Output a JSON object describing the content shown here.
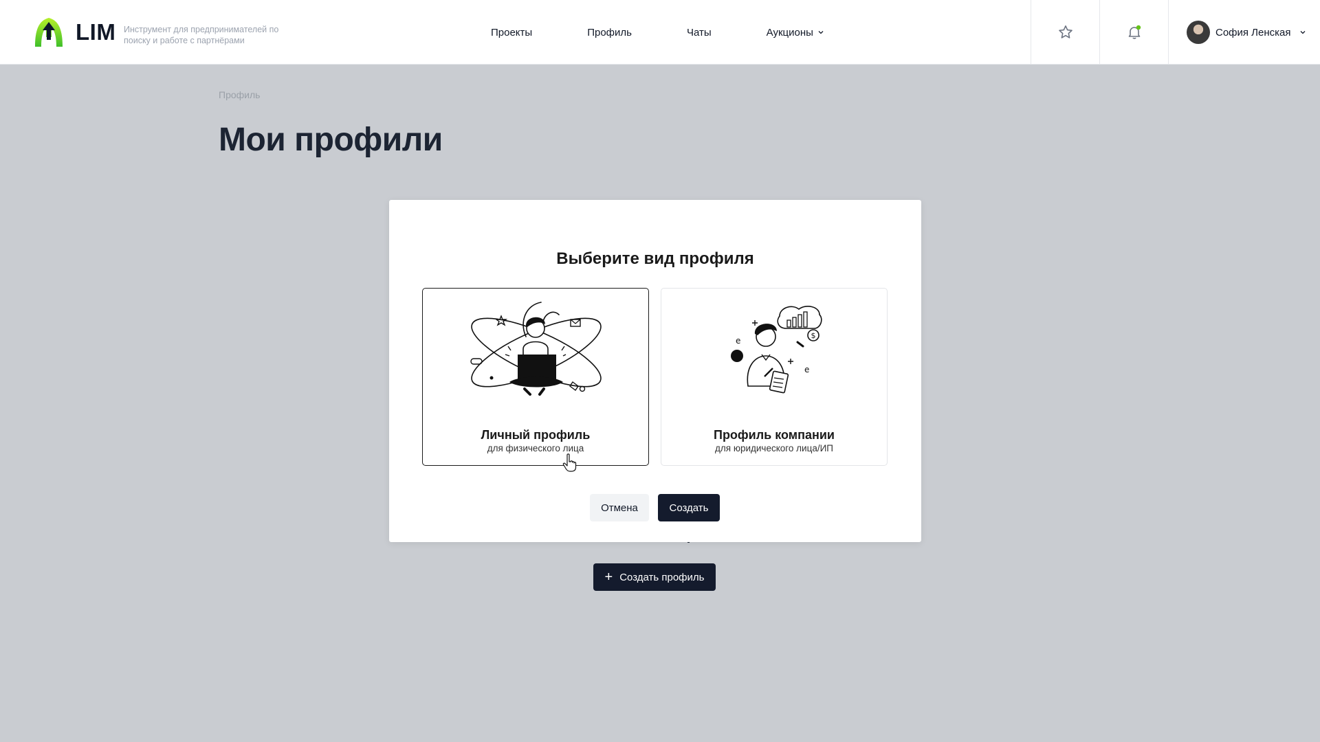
{
  "header": {
    "logo_text": "LIM",
    "tagline": "Инструмент для предпринимателей по поиску и работе с партнёрами",
    "nav": [
      {
        "label": "Проекты"
      },
      {
        "label": "Профиль"
      },
      {
        "label": "Чаты"
      },
      {
        "label": "Аукционы"
      }
    ],
    "user": {
      "name": "София Ленская"
    },
    "brand_color": "#7ed321",
    "notification_dot_color": "#65c318"
  },
  "page": {
    "breadcrumb": "Профиль",
    "title": "Мои профили",
    "create_profile_button": "Создать профиль"
  },
  "modal": {
    "title": "Выберите вид профиля",
    "options": [
      {
        "title": "Личный профиль",
        "subtitle": "для физического лица",
        "selected": true
      },
      {
        "title": "Профиль компании",
        "subtitle": "для юридического лица/ИП",
        "selected": false
      }
    ],
    "cancel_label": "Отмена",
    "create_label": "Создать"
  }
}
